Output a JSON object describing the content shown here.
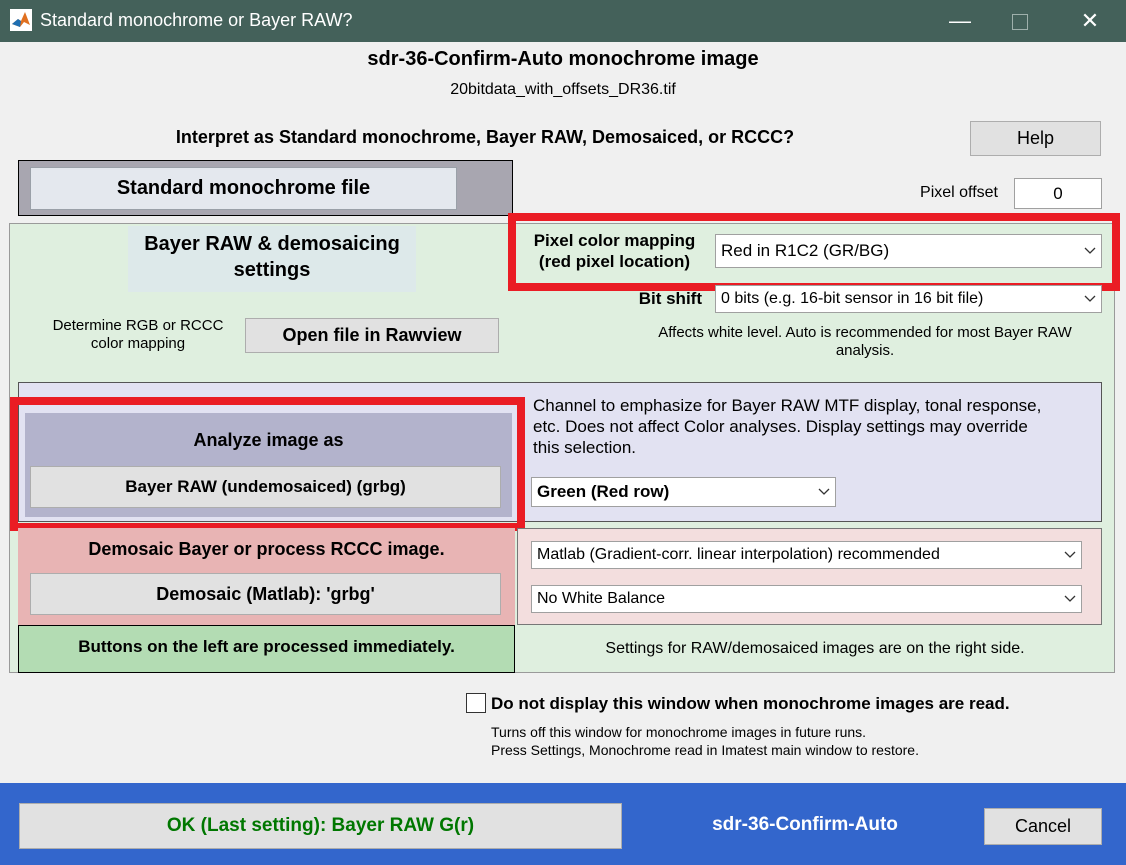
{
  "window": {
    "title": "Standard monochrome or Bayer RAW?",
    "heading": "sdr-36-Confirm-Auto monochrome image",
    "filename": "20bitdata_with_offsets_DR36.tif",
    "question": "Interpret as Standard monochrome, Bayer RAW, Demosaiced, or RCCC?"
  },
  "controls": {
    "help_label": "Help",
    "standard_mono_label": "Standard monochrome file",
    "pixel_offset_label": "Pixel offset",
    "pixel_offset_value": "0"
  },
  "bayer": {
    "section_title": "Bayer RAW & demosaicing settings",
    "pixel_color_label_line1": "Pixel color mapping",
    "pixel_color_label_line2": "(red pixel location)",
    "pixel_color_value": "Red in R1C2  (GR/BG)",
    "bit_shift_label": "Bit shift",
    "bit_shift_value": "0 bits (e.g. 16-bit sensor in 16 bit file)",
    "determine_text": "Determine RGB or RCCC color mapping",
    "open_rawview_label": "Open file in Rawview",
    "affects_note": "Affects white level. Auto is recommended for most Bayer RAW analysis."
  },
  "analyze": {
    "title": "Analyze image as",
    "button_label": "Bayer RAW (undemosaiced)  (grbg)",
    "channel_note": "Channel to emphasize for Bayer RAW MTF display, tonal response, etc. Does not affect Color analyses. Display settings may override this selection.",
    "channel_value": "Green (Red row)"
  },
  "demosaic": {
    "title": "Demosaic Bayer or process RCCC image.",
    "button_label": "Demosaic (Matlab):  'grbg'",
    "method_value": "Matlab   (Gradient-corr. linear interpolation)  recommended",
    "wb_value": "No White Balance"
  },
  "footer_notes": {
    "left_note": "Buttons on the left are processed immediately.",
    "right_note": "Settings for RAW/demosaiced images are on the right side."
  },
  "dont_display": {
    "label": "Do not display this window when monochrome images are read.",
    "note_line1": "Turns off this window for monochrome images in future runs.",
    "note_line2": "Press Settings, Monochrome read in Imatest main window to restore."
  },
  "bottom_bar": {
    "ok_label": "OK (Last setting):  Bayer RAW G(r)",
    "center_label": "sdr-36-Confirm-Auto",
    "cancel_label": "Cancel"
  },
  "icons": {
    "app": "matlab-icon",
    "minimize": "minimize-icon",
    "maximize": "maximize-icon",
    "close": "close-icon",
    "dropdown": "chevron-down-icon"
  },
  "colors": {
    "titlebar": "#44615a",
    "green_panel": "#dfefdf",
    "lavender_panel": "#e2e2f2",
    "pink_panel": "#f3dede",
    "highlight": "#ea1c24",
    "bottom_bar": "#3366cc",
    "ok_text": "#007700"
  }
}
